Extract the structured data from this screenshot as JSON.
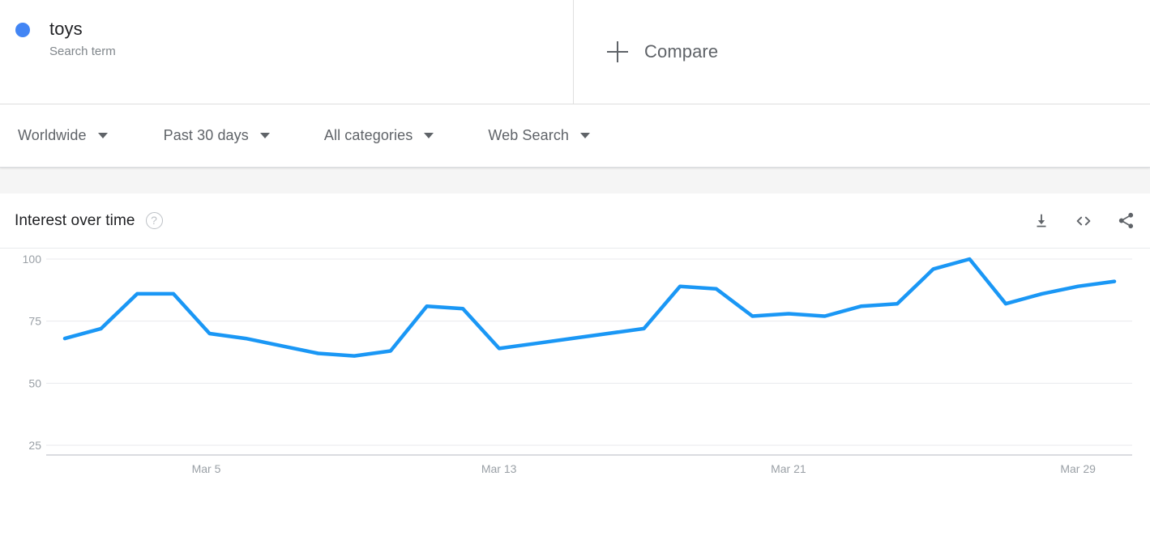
{
  "search_term": {
    "dot_color": "#4285f4",
    "title": "toys",
    "subtitle": "Search term"
  },
  "compare": {
    "plus_icon": "plus-icon",
    "label": "Compare"
  },
  "filters": [
    {
      "label": "Worldwide",
      "caret": "chevron-down-icon"
    },
    {
      "label": "Past 30 days",
      "caret": "chevron-down-icon"
    },
    {
      "label": "All categories",
      "caret": "chevron-down-icon"
    },
    {
      "label": "Web Search",
      "caret": "chevron-down-icon"
    }
  ],
  "chart_card": {
    "title": "Interest over time",
    "help_icon": "help-circle-icon",
    "help_glyph": "?",
    "actions": [
      {
        "name": "download-icon",
        "label": "Download"
      },
      {
        "name": "embed-icon",
        "label": "Embed"
      },
      {
        "name": "share-icon",
        "label": "Share"
      }
    ]
  },
  "chart_data": {
    "type": "line",
    "title": "Interest over time",
    "xlabel": "",
    "ylabel": "",
    "line_color": "#1a97f5",
    "grid": true,
    "legend": false,
    "ylim": [
      0,
      108
    ],
    "yticks": [
      25,
      50,
      75,
      100
    ],
    "xticks": [
      "Mar 5",
      "Mar 13",
      "Mar 21",
      "Mar 29"
    ],
    "xtick_indices": [
      4,
      12,
      20,
      28
    ],
    "x": [
      "Mar 1",
      "Mar 2",
      "Mar 3",
      "Mar 4",
      "Mar 5",
      "Mar 6",
      "Mar 7",
      "Mar 8",
      "Mar 9",
      "Mar 10",
      "Mar 11",
      "Mar 12",
      "Mar 13",
      "Mar 14",
      "Mar 15",
      "Mar 16",
      "Mar 17",
      "Mar 18",
      "Mar 19",
      "Mar 20",
      "Mar 21",
      "Mar 22",
      "Mar 23",
      "Mar 24",
      "Mar 25",
      "Mar 26",
      "Mar 27",
      "Mar 28",
      "Mar 29",
      "Mar 30"
    ],
    "series": [
      {
        "name": "toys",
        "values": [
          68,
          72,
          86,
          86,
          70,
          68,
          65,
          62,
          61,
          63,
          81,
          80,
          64,
          66,
          68,
          70,
          72,
          89,
          88,
          77,
          78,
          77,
          81,
          82,
          96,
          100,
          82,
          86,
          89,
          91
        ]
      }
    ]
  }
}
